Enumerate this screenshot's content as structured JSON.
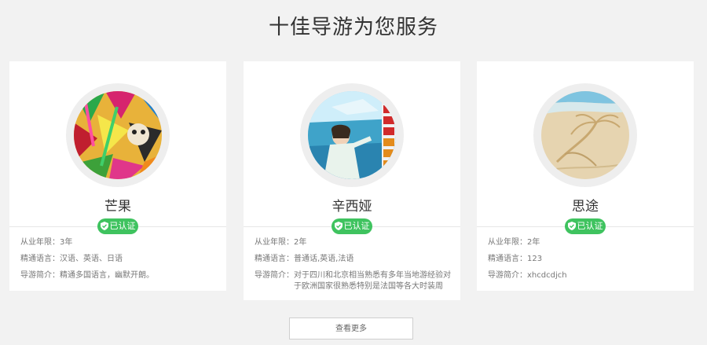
{
  "section": {
    "title": "十佳导游为您服务"
  },
  "guides": [
    {
      "name": "芒果",
      "badge": "已认证",
      "years_label": "从业年限：",
      "years": "3年",
      "languages_label": "精通语言：",
      "languages": "汉语、英语、日语",
      "intro_label": "导游简介：",
      "intro": "精通多国语言，幽默开朗。"
    },
    {
      "name": "辛西娅",
      "badge": "已认证",
      "years_label": "从业年限：",
      "years": "2年",
      "languages_label": "精通语言：",
      "languages": "普通话,英语,法语",
      "intro_label": "导游简介：",
      "intro": "对于四川和北京相当熟悉有多年当地游经验对于欧洲国家很熟悉特别是法国等各大时装周"
    },
    {
      "name": "思途",
      "badge": "已认证",
      "years_label": "从业年限：",
      "years": "2年",
      "languages_label": "精通语言：",
      "languages": "123",
      "intro_label": "导游简介：",
      "intro": "xhcdcdjch"
    }
  ],
  "more_button": {
    "label": "查看更多"
  },
  "colors": {
    "badge": "#3fc35f",
    "background": "#f2f2f2",
    "card": "#ffffff"
  },
  "icons": {
    "badge_icon": "shield-check-icon"
  }
}
